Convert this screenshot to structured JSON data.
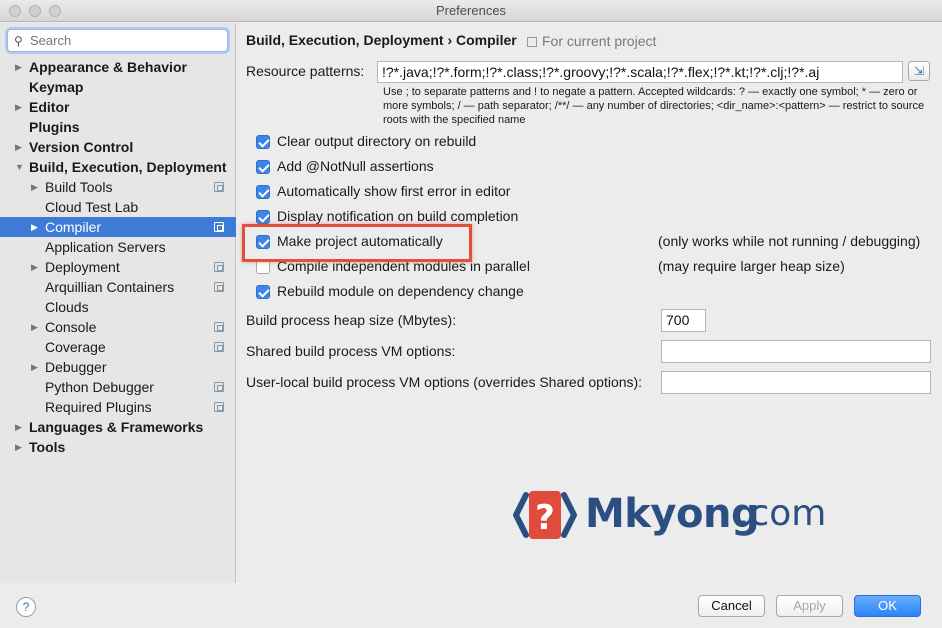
{
  "window": {
    "title": "Preferences"
  },
  "search": {
    "placeholder": "Search"
  },
  "sidebar": {
    "items": [
      {
        "label": "Appearance & Behavior",
        "bold": true,
        "indent": 0,
        "arrow": "right",
        "copy": false,
        "selected": false
      },
      {
        "label": "Keymap",
        "bold": true,
        "indent": 0,
        "arrow": "",
        "copy": false,
        "selected": false
      },
      {
        "label": "Editor",
        "bold": true,
        "indent": 0,
        "arrow": "right",
        "copy": false,
        "selected": false
      },
      {
        "label": "Plugins",
        "bold": true,
        "indent": 0,
        "arrow": "",
        "copy": false,
        "selected": false
      },
      {
        "label": "Version Control",
        "bold": true,
        "indent": 0,
        "arrow": "right",
        "copy": false,
        "selected": false
      },
      {
        "label": "Build, Execution, Deployment",
        "bold": true,
        "indent": 0,
        "arrow": "down",
        "copy": false,
        "selected": false
      },
      {
        "label": "Build Tools",
        "bold": false,
        "indent": 1,
        "arrow": "right",
        "copy": true,
        "selected": false
      },
      {
        "label": "Cloud Test Lab",
        "bold": false,
        "indent": 1,
        "arrow": "",
        "copy": false,
        "selected": false
      },
      {
        "label": "Compiler",
        "bold": false,
        "indent": 1,
        "arrow": "right",
        "copy": true,
        "selected": true
      },
      {
        "label": "Application Servers",
        "bold": false,
        "indent": 1,
        "arrow": "",
        "copy": false,
        "selected": false
      },
      {
        "label": "Deployment",
        "bold": false,
        "indent": 1,
        "arrow": "right",
        "copy": true,
        "selected": false
      },
      {
        "label": "Arquillian Containers",
        "bold": false,
        "indent": 1,
        "arrow": "",
        "copy": true,
        "selected": false
      },
      {
        "label": "Clouds",
        "bold": false,
        "indent": 1,
        "arrow": "",
        "copy": false,
        "selected": false
      },
      {
        "label": "Console",
        "bold": false,
        "indent": 1,
        "arrow": "right",
        "copy": true,
        "selected": false
      },
      {
        "label": "Coverage",
        "bold": false,
        "indent": 1,
        "arrow": "",
        "copy": true,
        "selected": false
      },
      {
        "label": "Debugger",
        "bold": false,
        "indent": 1,
        "arrow": "right",
        "copy": false,
        "selected": false
      },
      {
        "label": "Python Debugger",
        "bold": false,
        "indent": 1,
        "arrow": "",
        "copy": true,
        "selected": false
      },
      {
        "label": "Required Plugins",
        "bold": false,
        "indent": 1,
        "arrow": "",
        "copy": true,
        "selected": false
      },
      {
        "label": "Languages & Frameworks",
        "bold": true,
        "indent": 0,
        "arrow": "right",
        "copy": false,
        "selected": false
      },
      {
        "label": "Tools",
        "bold": true,
        "indent": 0,
        "arrow": "right",
        "copy": false,
        "selected": false
      }
    ]
  },
  "main": {
    "breadcrumb": "Build, Execution, Deployment › Compiler",
    "scope_note": "For current project",
    "resource_patterns": {
      "label": "Resource patterns:",
      "value": "!?*.java;!?*.form;!?*.class;!?*.groovy;!?*.scala;!?*.flex;!?*.kt;!?*.clj;!?*.aj",
      "hint": "Use ; to separate patterns and ! to negate a pattern. Accepted wildcards: ? — exactly one symbol; * — zero or more symbols; / — path separator; /**/ — any number of directories; <dir_name>:<pattern> — restrict to source roots with the specified name"
    },
    "checkboxes": [
      {
        "label": "Clear output directory on rebuild",
        "checked": true,
        "note": ""
      },
      {
        "label": "Add @NotNull assertions",
        "checked": true,
        "note": ""
      },
      {
        "label": "Automatically show first error in editor",
        "checked": true,
        "note": ""
      },
      {
        "label": "Display notification on build completion",
        "checked": true,
        "note": ""
      },
      {
        "label": "Make project automatically",
        "checked": true,
        "note": "(only works while not running / debugging)"
      },
      {
        "label": "Compile independent modules in parallel",
        "checked": false,
        "note": "(may require larger heap size)"
      },
      {
        "label": "Rebuild module on dependency change",
        "checked": true,
        "note": ""
      }
    ],
    "heap_size": {
      "label": "Build process heap size (Mbytes):",
      "value": "700"
    },
    "shared_vm": {
      "label": "Shared build process VM options:",
      "value": ""
    },
    "user_vm": {
      "label": "User-local build process VM options (overrides Shared options):",
      "value": ""
    }
  },
  "watermark": {
    "brand": "Mkyong",
    "tld": ".com",
    "mark_char": "?"
  },
  "footer": {
    "help": "?",
    "cancel": "Cancel",
    "apply": "Apply",
    "ok": "OK"
  },
  "colors": {
    "selection": "#3e7bd6",
    "checkbox": "#3b86e8",
    "highlight_box": "#e0503d",
    "primary_button": "#2a84f6",
    "brand": "#2b4f82",
    "brand_mark": "#e04b3b"
  }
}
